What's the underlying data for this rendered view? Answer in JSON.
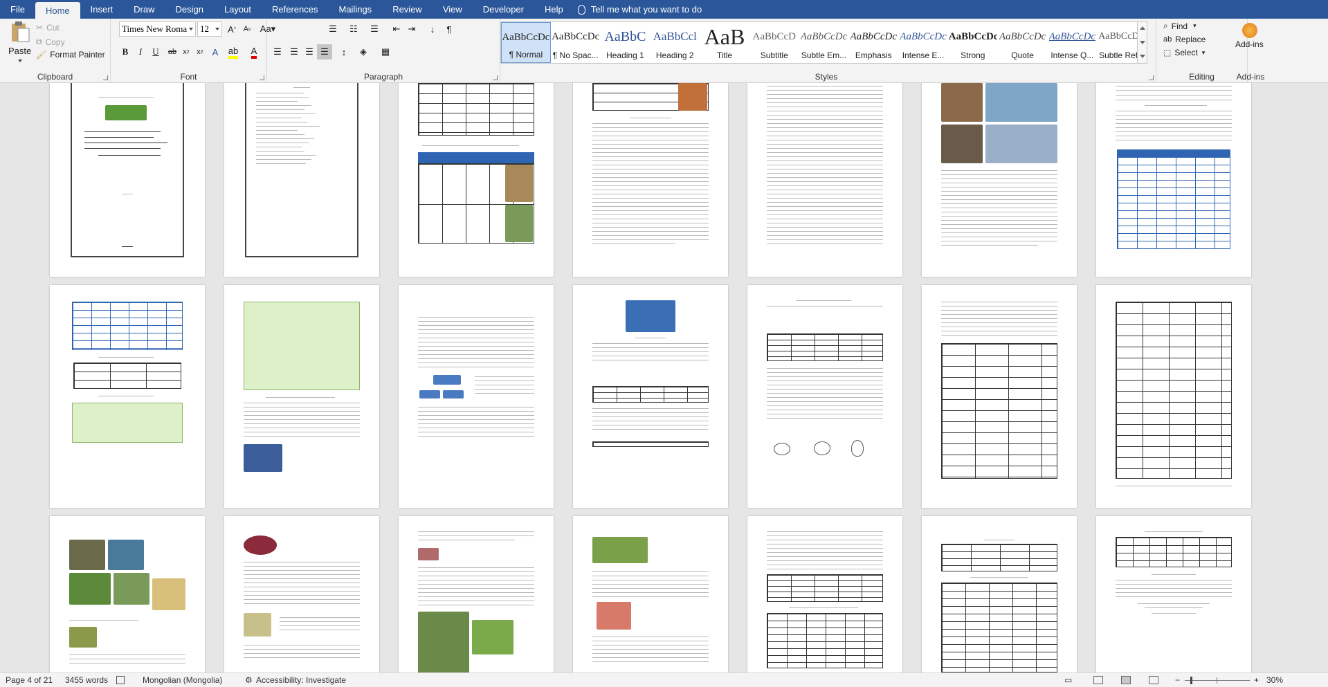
{
  "ribbon_tabs": [
    "File",
    "Home",
    "Insert",
    "Draw",
    "Design",
    "Layout",
    "References",
    "Mailings",
    "Review",
    "View",
    "Developer",
    "Help"
  ],
  "tell_me": "Tell me what you want to do",
  "clipboard": {
    "paste": "Paste",
    "cut": "Cut",
    "copy": "Copy",
    "format_painter": "Format Painter",
    "label": "Clipboard"
  },
  "font": {
    "name": "Times New Roma",
    "size": "12",
    "label": "Font"
  },
  "paragraph": {
    "label": "Paragraph"
  },
  "styles": {
    "label": "Styles",
    "items": [
      {
        "preview": "AaBbCcDc",
        "name": "¶ Normal"
      },
      {
        "preview": "AaBbCcDc",
        "name": "¶ No Spac..."
      },
      {
        "preview": "AaBbC",
        "name": "Heading 1"
      },
      {
        "preview": "AaBbCcl",
        "name": "Heading 2"
      },
      {
        "preview": "AaB",
        "name": "Title"
      },
      {
        "preview": "AaBbCcD",
        "name": "Subtitle"
      },
      {
        "preview": "AaBbCcDc",
        "name": "Subtle Em..."
      },
      {
        "preview": "AaBbCcDc",
        "name": "Emphasis"
      },
      {
        "preview": "AaBbCcDc",
        "name": "Intense E..."
      },
      {
        "preview": "AaBbCcDc",
        "name": "Strong"
      },
      {
        "preview": "AaBbCcDc",
        "name": "Quote"
      },
      {
        "preview": "AaBbCcDc",
        "name": "Intense Q..."
      },
      {
        "preview": "AaBbCcDC",
        "name": "Subtle Ref..."
      }
    ]
  },
  "editing": {
    "find": "Find",
    "replace": "Replace",
    "select": "Select",
    "label": "Editing"
  },
  "addins": {
    "button": "Add-ins",
    "label": "Add-ins"
  },
  "status": {
    "page": "Page 4 of 21",
    "words": "3455 words",
    "language": "Mongolian (Mongolia)",
    "accessibility": "Accessibility: Investigate",
    "zoom": "30%"
  },
  "colors": {
    "accent": "#2b579a",
    "ribbon": "#f3f3f3",
    "canvas": "#e6e6e6",
    "table_header": "#2f64b3",
    "highlight_green": "#ddf0c8"
  }
}
